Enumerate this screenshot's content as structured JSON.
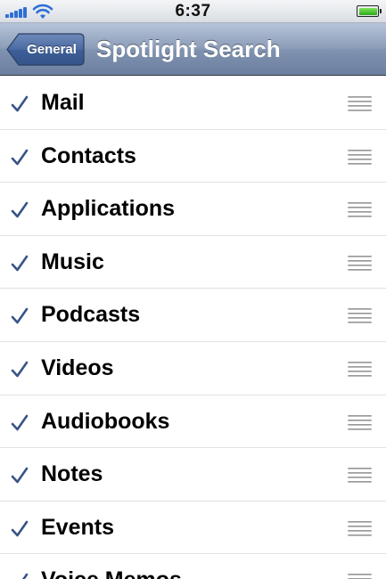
{
  "status_bar": {
    "time": "6:37"
  },
  "nav": {
    "back_label": "General",
    "title": "Spotlight Search"
  },
  "search_items": [
    {
      "label": "Mail",
      "checked": true
    },
    {
      "label": "Contacts",
      "checked": true
    },
    {
      "label": "Applications",
      "checked": true
    },
    {
      "label": "Music",
      "checked": true
    },
    {
      "label": "Podcasts",
      "checked": true
    },
    {
      "label": "Videos",
      "checked": true
    },
    {
      "label": "Audiobooks",
      "checked": true
    },
    {
      "label": "Notes",
      "checked": true
    },
    {
      "label": "Events",
      "checked": true
    },
    {
      "label": "Voice Memos",
      "checked": true
    }
  ],
  "icons": {
    "check": "check-icon",
    "reorder": "reorder-handle-icon"
  },
  "colors": {
    "nav_bar": "#8c9db9",
    "checkmark": "#385487",
    "row_separator": "#e1e1e1"
  }
}
